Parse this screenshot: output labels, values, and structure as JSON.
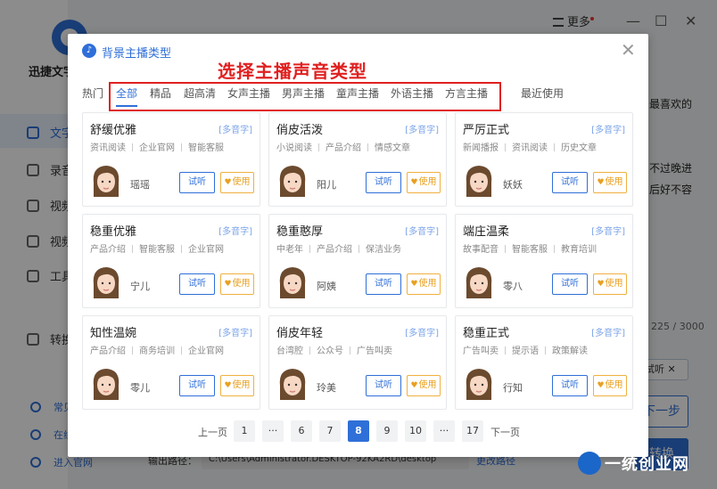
{
  "app": {
    "name": "迅捷文字",
    "nav": [
      {
        "label": "文字",
        "active": true,
        "icon": "text-icon"
      },
      {
        "label": "录音",
        "active": false,
        "icon": "record-icon"
      },
      {
        "label": "视频",
        "active": false,
        "icon": "video-icon"
      },
      {
        "label": "视频",
        "active": false,
        "icon": "video-icon"
      },
      {
        "label": "工具",
        "active": false,
        "icon": "toolbox-icon"
      },
      {
        "label": "转换",
        "active": false,
        "icon": "convert-icon"
      }
    ],
    "bottom_links": [
      "常见",
      "在线",
      "进入官网"
    ],
    "more_label": "更多",
    "right_texts": [
      "最喜欢的",
      "不过晚进",
      "后好不容"
    ],
    "char_count": "225 / 3000",
    "chip_label": "试听",
    "next_label": "下一步",
    "convert_label": "转换",
    "output_label": "输出路径：",
    "output_path": "C:\\Users\\Administrator.DESKTOP-92KA2RD\\desktop",
    "change_path_label": "更改路径"
  },
  "modal": {
    "title": "背景主播类型",
    "annotation": "选择主播声音类型",
    "tabs": [
      {
        "label": "热门",
        "active": false
      },
      {
        "label": "全部",
        "active": true
      },
      {
        "label": "精品",
        "active": false
      },
      {
        "label": "超高清",
        "active": false
      },
      {
        "label": "女声主播",
        "active": false
      },
      {
        "label": "男声主播",
        "active": false
      },
      {
        "label": "童声主播",
        "active": false
      },
      {
        "label": "外语主播",
        "active": false
      },
      {
        "label": "方言主播",
        "active": false
      },
      {
        "label": "最近使用",
        "active": false
      }
    ],
    "listen_label": "试听",
    "use_label": "使用",
    "cards": [
      {
        "name": "舒缓优雅",
        "badge": "[多音字]",
        "tags": [
          "资讯阅读",
          "企业官网",
          "智能客服"
        ],
        "voice": "瑶瑶"
      },
      {
        "name": "俏皮活泼",
        "badge": "[多音字]",
        "tags": [
          "小说阅读",
          "产品介绍",
          "情感文章"
        ],
        "voice": "阳儿"
      },
      {
        "name": "严厉正式",
        "badge": "[多音字]",
        "tags": [
          "新闻播报",
          "资讯阅读",
          "历史文章"
        ],
        "voice": "妖妖"
      },
      {
        "name": "稳重优雅",
        "badge": "[多音字]",
        "tags": [
          "产品介绍",
          "智能客服",
          "企业官网"
        ],
        "voice": "宁儿"
      },
      {
        "name": "稳重憨厚",
        "badge": "[多音字]",
        "tags": [
          "中老年",
          "产品介绍",
          "保洁业务"
        ],
        "voice": "阿姨"
      },
      {
        "name": "端庄温柔",
        "badge": "[多音字]",
        "tags": [
          "故事配音",
          "智能客服",
          "教育培训"
        ],
        "voice": "零八"
      },
      {
        "name": "知性温婉",
        "badge": "[多音字]",
        "tags": [
          "产品介绍",
          "商务培训",
          "企业官网"
        ],
        "voice": "零儿"
      },
      {
        "name": "俏皮年轻",
        "badge": "[多音字]",
        "tags": [
          "台湾腔",
          "公众号",
          "广告叫卖"
        ],
        "voice": "玲美"
      },
      {
        "name": "稳重正式",
        "badge": "[多音字]",
        "tags": [
          "广告叫卖",
          "提示语",
          "政策解读"
        ],
        "voice": "行知"
      }
    ],
    "pager": {
      "prev": "上一页",
      "next": "下一页",
      "pages": [
        "1",
        "···",
        "6",
        "7",
        "8",
        "9",
        "10",
        "···",
        "17"
      ],
      "current": "8"
    }
  },
  "watermark": "一统创业网",
  "colors": {
    "accent": "#2f6fd8",
    "annotation_red": "#e02020",
    "use_orange": "#e8a020"
  }
}
